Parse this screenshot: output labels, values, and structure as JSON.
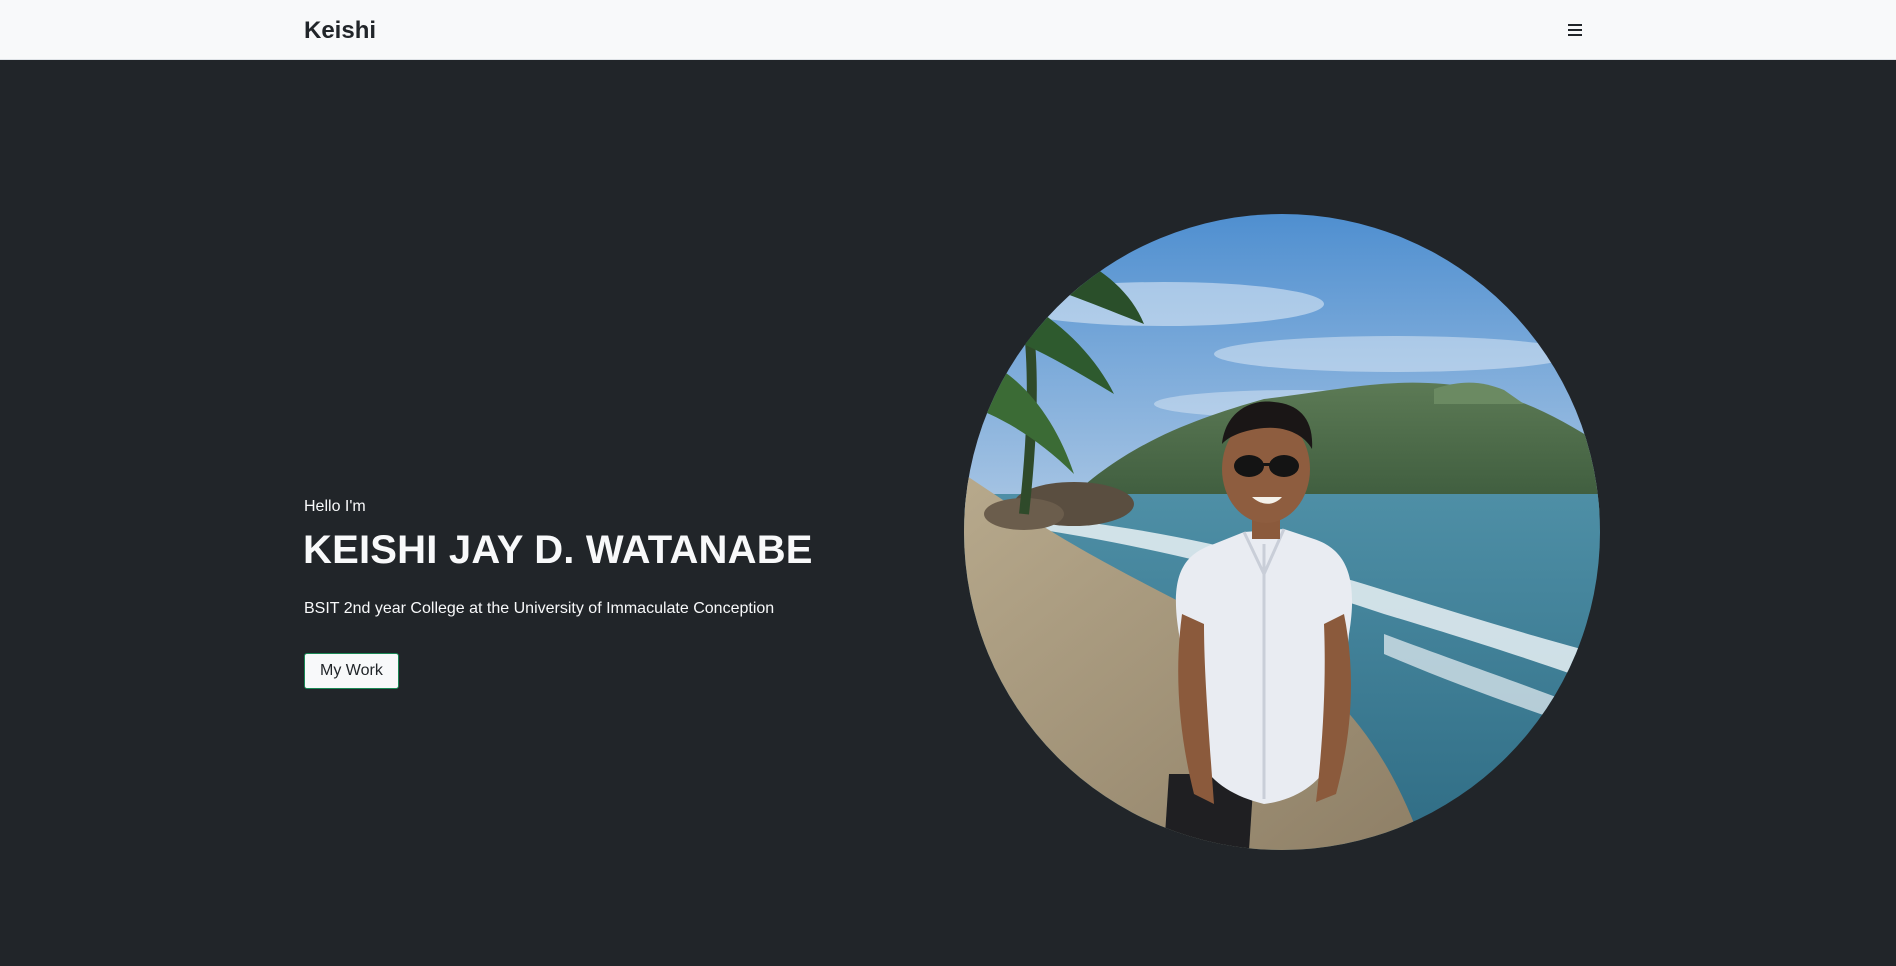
{
  "navbar": {
    "brand": "Keishi",
    "menu_icon": "hamburger-menu-icon",
    "background": "#f8f9fa"
  },
  "hero": {
    "greeting": "Hello I'm",
    "name": "KEISHI JAY D. WATANABE",
    "tagline": "BSIT 2nd year College at the University of Immaculate Conception",
    "cta_label": "My Work",
    "background": "#212529",
    "accent": "#198754",
    "photo_alt": "Profile photo"
  }
}
